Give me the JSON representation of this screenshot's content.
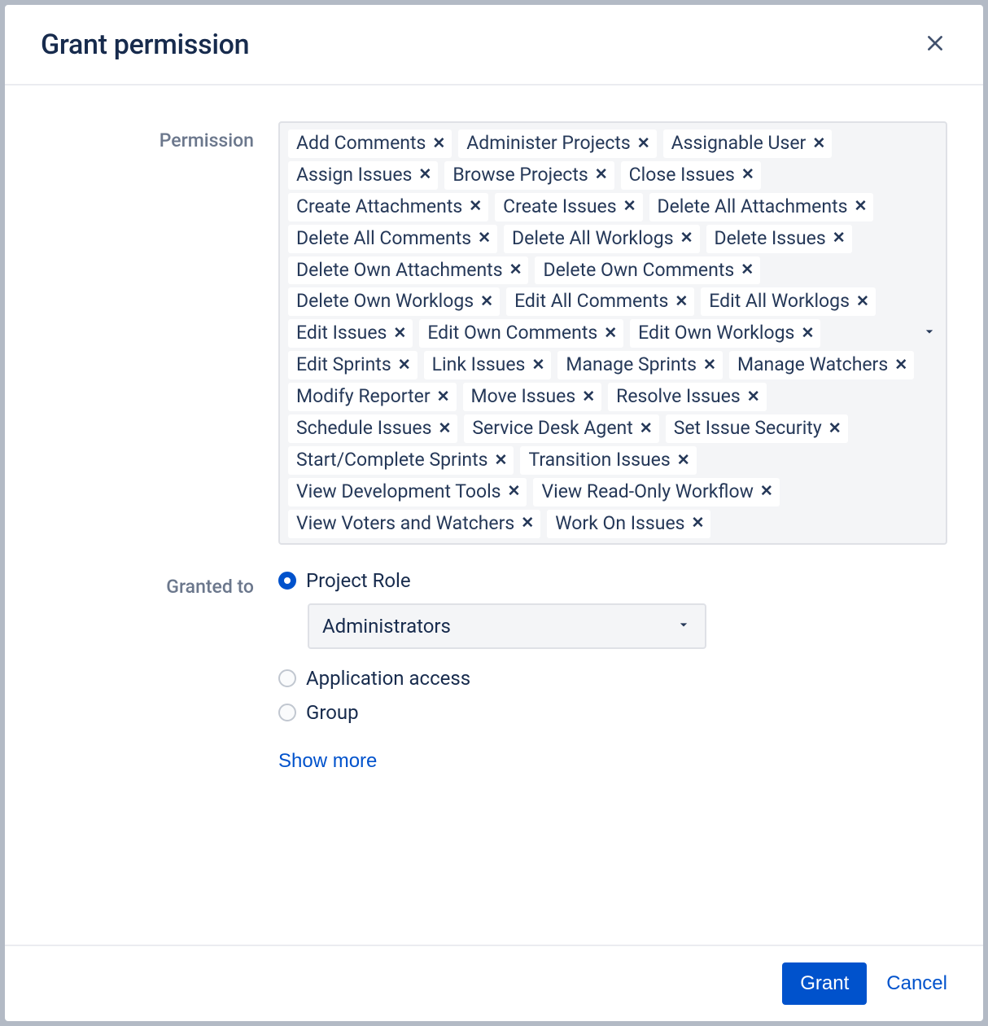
{
  "dialog": {
    "title": "Grant permission"
  },
  "fields": {
    "permission_label": "Permission",
    "granted_to_label": "Granted to"
  },
  "permissions": [
    "Add Comments",
    "Administer Projects",
    "Assignable User",
    "Assign Issues",
    "Browse Projects",
    "Close Issues",
    "Create Attachments",
    "Create Issues",
    "Delete All Attachments",
    "Delete All Comments",
    "Delete All Worklogs",
    "Delete Issues",
    "Delete Own Attachments",
    "Delete Own Comments",
    "Delete Own Worklogs",
    "Edit All Comments",
    "Edit All Worklogs",
    "Edit Issues",
    "Edit Own Comments",
    "Edit Own Worklogs",
    "Edit Sprints",
    "Link Issues",
    "Manage Sprints",
    "Manage Watchers",
    "Modify Reporter",
    "Move Issues",
    "Resolve Issues",
    "Schedule Issues",
    "Service Desk Agent",
    "Set Issue Security",
    "Start/Complete Sprints",
    "Transition Issues",
    "View Development Tools",
    "View Read-Only Workflow",
    "View Voters and Watchers",
    "Work On Issues"
  ],
  "granted_to": {
    "options": [
      {
        "label": "Project Role",
        "checked": true
      },
      {
        "label": "Application access",
        "checked": false
      },
      {
        "label": "Group",
        "checked": false
      }
    ],
    "role_select_value": "Administrators",
    "show_more": "Show more"
  },
  "footer": {
    "grant": "Grant",
    "cancel": "Cancel"
  }
}
